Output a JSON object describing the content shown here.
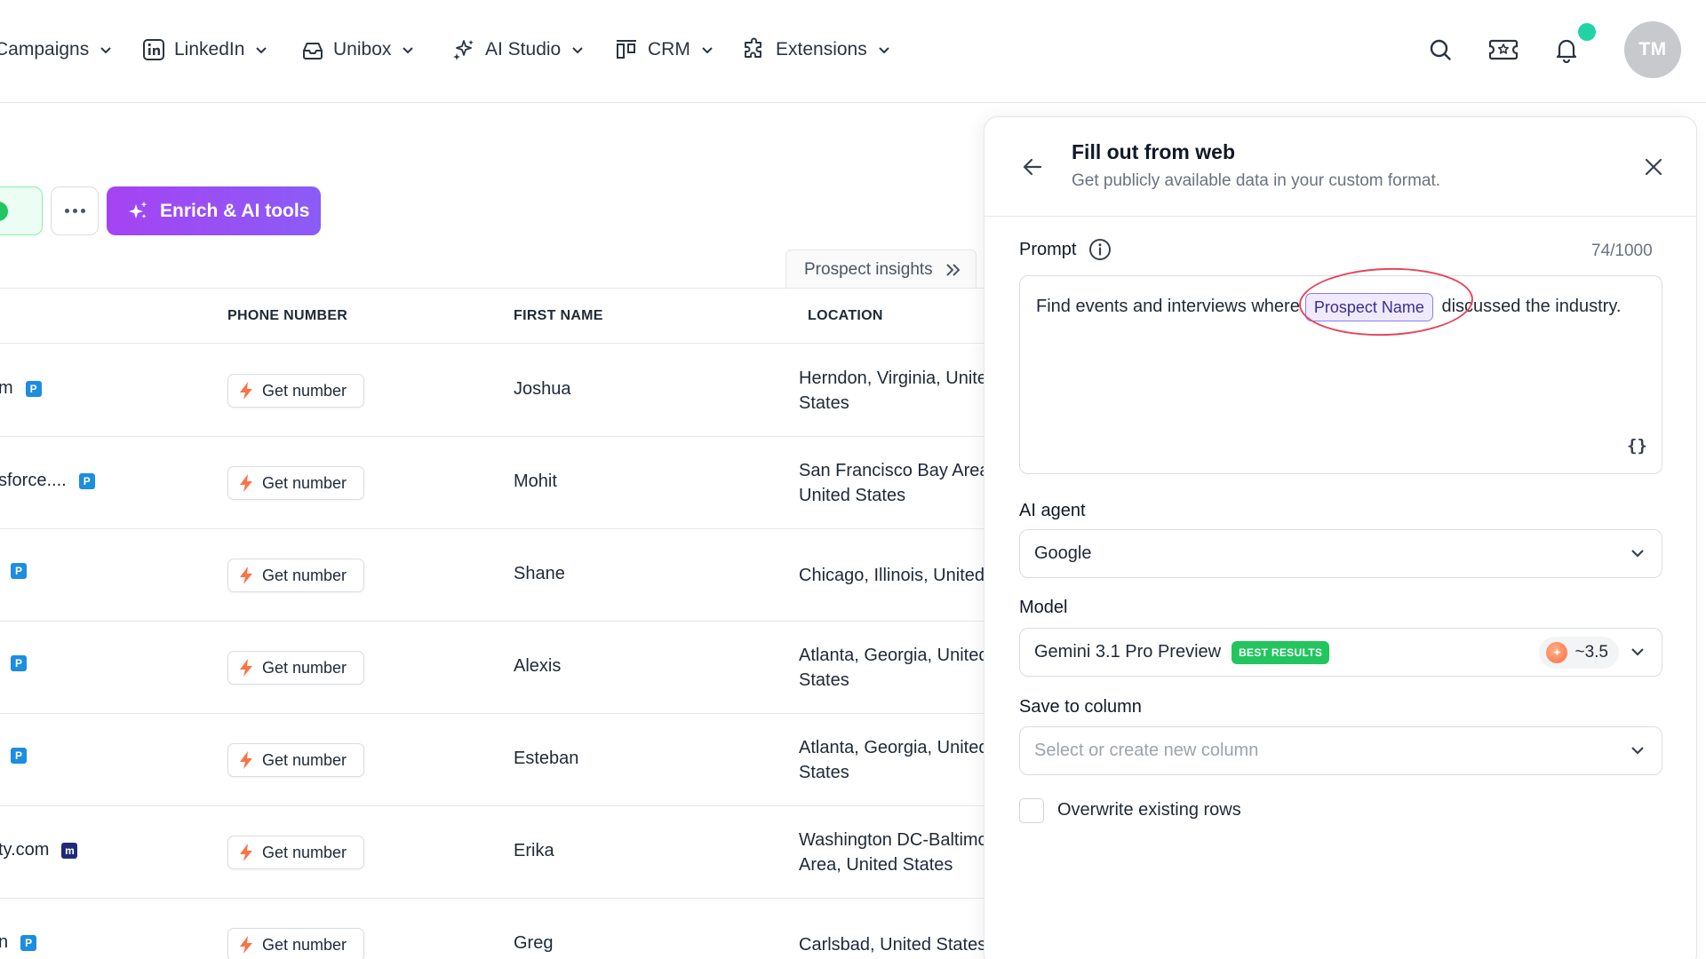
{
  "nav": {
    "items": [
      {
        "label": "Campaigns",
        "icon": "campaigns-icon"
      },
      {
        "label": "LinkedIn",
        "icon": "linkedin-icon"
      },
      {
        "label": "Unibox",
        "icon": "inbox-icon"
      },
      {
        "label": "AI Studio",
        "icon": "sparkles-icon"
      },
      {
        "label": "CRM",
        "icon": "kanban-icon"
      },
      {
        "label": "Extensions",
        "icon": "puzzle-icon"
      }
    ],
    "avatar_initials": "TM"
  },
  "toolbar": {
    "more_label": "More",
    "enrich_label": "Enrich & AI tools"
  },
  "insights_tab": {
    "label": "Prospect insights"
  },
  "table": {
    "columns": [
      "PHONE NUMBER",
      "FIRST NAME",
      "LOCATION"
    ],
    "get_number_label": "Get number",
    "rows": [
      {
        "email": "m",
        "badge": "P",
        "first": "Joshua",
        "loc1": "Herndon, Virginia, United",
        "loc2": "States"
      },
      {
        "email": "sforce....",
        "badge": "P",
        "first": "Mohit",
        "loc1": "San Francisco Bay Area,",
        "loc2": "United States"
      },
      {
        "email": "",
        "badge": "P",
        "first": "Shane",
        "loc1": "Chicago, Illinois, United States",
        "loc2": ""
      },
      {
        "email": "",
        "badge": "P",
        "first": "Alexis",
        "loc1": "Atlanta, Georgia, United",
        "loc2": "States"
      },
      {
        "email": "",
        "badge": "P",
        "first": "Esteban",
        "loc1": "Atlanta, Georgia, United",
        "loc2": "States"
      },
      {
        "email": "ty.com",
        "badge": "m",
        "first": "Erika",
        "loc1": "Washington DC-Baltimore",
        "loc2": "Area, United States"
      },
      {
        "email": "n",
        "badge": "P",
        "first": "Greg",
        "loc1": "Carlsbad, United States",
        "loc2": ""
      }
    ]
  },
  "panel": {
    "title": "Fill out from web",
    "subtitle": "Get publicly available data in your custom format.",
    "prompt_label": "Prompt",
    "counter": "74/1000",
    "prompt_before": "Find events and interviews where",
    "prompt_chip": "Prospect Name",
    "prompt_after": "discussed the industry.",
    "braces": "{}",
    "agent_label": "AI agent",
    "agent_value": "Google",
    "model_label": "Model",
    "model_value": "Gemini 3.1 Pro Preview",
    "model_badge": "BEST RESULTS",
    "model_credits": "~3.5",
    "save_label": "Save to column",
    "save_placeholder": "Select or create new column",
    "overwrite_label": "Overwrite existing rows"
  },
  "colors": {
    "accent_purple": "#a543f3",
    "badge_green": "#22c55e",
    "notif_dot": "#22d3a6",
    "highlight_circle": "#e8445a"
  }
}
